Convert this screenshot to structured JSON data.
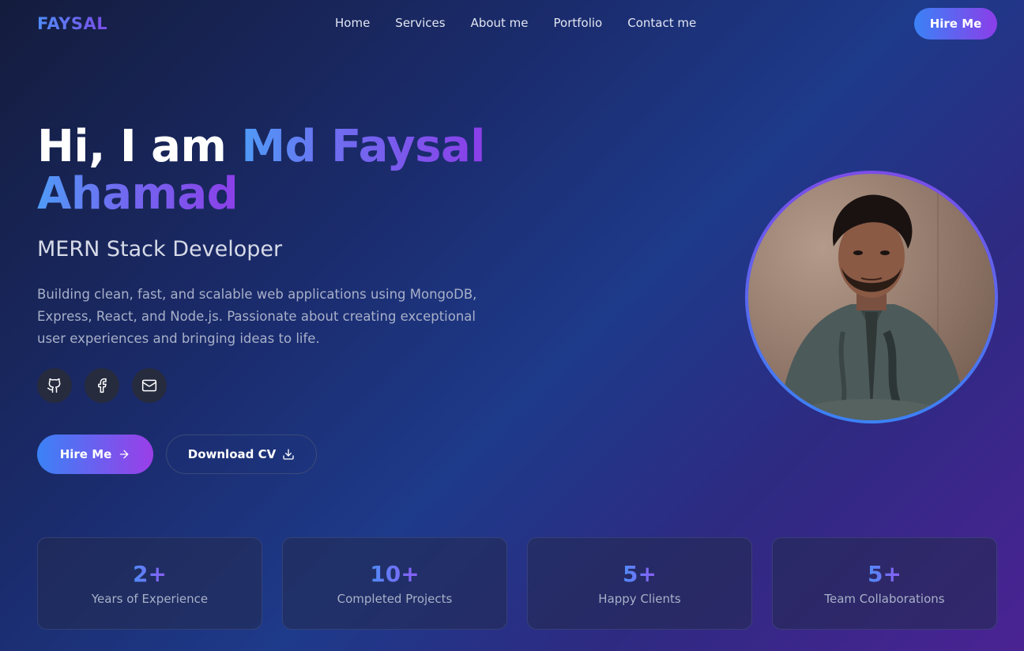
{
  "nav": {
    "logo": "FAYSAL",
    "links": [
      "Home",
      "Services",
      "About me",
      "Portfolio",
      "Contact me"
    ],
    "hire_label": "Hire Me"
  },
  "hero": {
    "greeting": "Hi, I am ",
    "name_line1": "Md Faysal",
    "name_line2": "Ahamad",
    "role": "MERN Stack Developer",
    "description": "Building clean, fast, and scalable web applications using MongoDB, Express, React, and Node.js. Passionate about creating exceptional user experiences and bringing ideas to life.",
    "socials": [
      "github-icon",
      "facebook-icon",
      "mail-icon"
    ],
    "hire_button": "Hire Me",
    "cv_button": "Download CV"
  },
  "stats": [
    {
      "value": "2+",
      "label": "Years of Experience"
    },
    {
      "value": "10+",
      "label": "Completed Projects"
    },
    {
      "value": "5+",
      "label": "Happy Clients"
    },
    {
      "value": "5+",
      "label": "Team Collaborations"
    }
  ],
  "colors": {
    "accent_blue": "#3b82f6",
    "accent_purple": "#8b3ee8",
    "background_start": "#141c3d",
    "background_end": "#4a2393"
  }
}
